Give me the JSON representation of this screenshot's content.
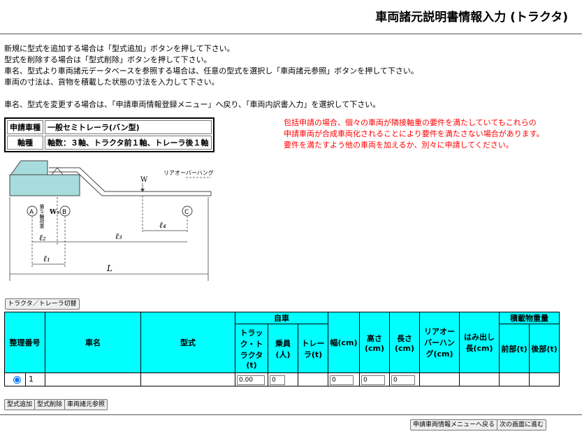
{
  "page": {
    "title": "車両諸元説明書情報入力 (トラクタ)"
  },
  "instructions": [
    "新規に型式を追加する場合は「型式追加」ボタンを押して下さい。",
    "型式を削除する場合は「型式削除」ボタンを押して下さい。",
    "車名、型式より車両諸元データベースを参照する場合は、任意の型式を選択し「車両諸元参照」ボタンを押して下さい。",
    "車両の寸法は、貨物を積載した状態の寸法を入力して下さい。",
    "",
    "車名、型式を変更する場合は、「申請車両情報登録メニュー」へ戻り、「車両内訳書入力」を選択して下さい。"
  ],
  "info": {
    "type_label": "申請車種",
    "type_value": "一般セミトレーラ(バン型)",
    "axle_label": "軸種",
    "axle_value": "軸数：３軸、トラクタ前１軸、トレーラ後１軸"
  },
  "warning": [
    "包括申請の場合、個々の車両が隣接軸重の要件を満たしていてもこれらの",
    "申請車両が合成車両化されることにより要件を満たさない場合があります。",
    "要件を満たすよう他の車両を加えるか、別々に申請してください。"
  ],
  "diagram": {
    "rear_overhang": "リアオーバーハング",
    "w": "W",
    "point_a": "A",
    "point_b": "B",
    "point_c": "C",
    "w5": "W₅",
    "coupler": "第５輪荷重",
    "l1": "ℓ₁",
    "l2": "ℓ₂",
    "l3": "ℓ₃",
    "l4": "ℓ₄",
    "L": "L"
  },
  "buttons": {
    "switch": "トラクタ／トレーラ切替",
    "add_type": "型式追加",
    "delete_type": "型式削除",
    "ref_spec": "車両諸元参照",
    "back_menu": "申請車両情報メニューへ戻る",
    "next": "次の画面に進む"
  },
  "table": {
    "headers": {
      "number": "整理番号",
      "name": "車名",
      "model": "型式",
      "own": "自車",
      "tractor": "トラック・トラクタ(t)",
      "crew": "乗員(人)",
      "trailer": "トレーラ(t)",
      "width": "幅(cm)",
      "height": "高さ(cm)",
      "length": "長さ(cm)",
      "rear_overhang": "リアオーバーハング(cm)",
      "overhang": "はみ出し長(cm)",
      "cargo": "積載物重量",
      "front": "前部(t)",
      "rear": "後部(t)"
    },
    "rows": [
      {
        "index": "1",
        "name": "",
        "model": "",
        "tractor": "0.00",
        "crew": "0",
        "trailer": "",
        "width": "0",
        "height": "0",
        "length": "0",
        "rear_overhang": "",
        "overhang": "",
        "front": "",
        "rear": ""
      }
    ]
  }
}
